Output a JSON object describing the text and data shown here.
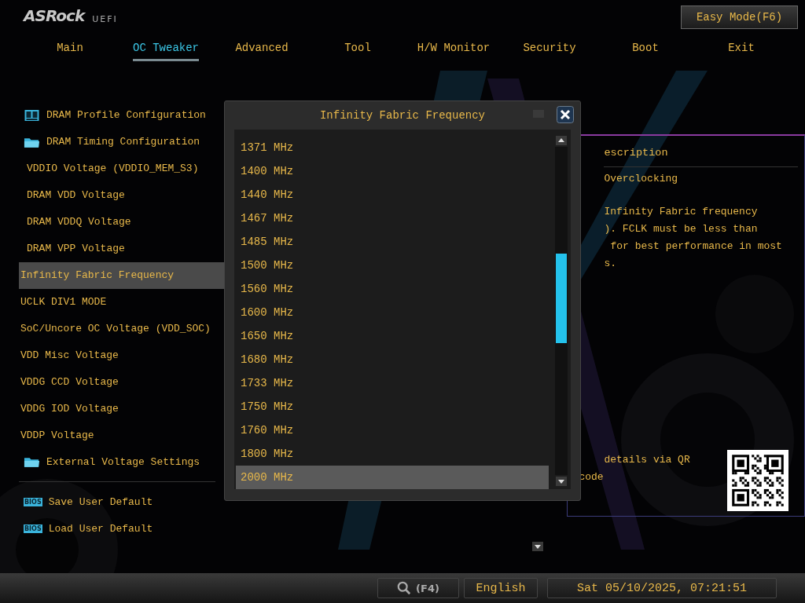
{
  "header": {
    "logo": "ASRock",
    "logo_suffix": "UEFI",
    "easy_mode_button": "Easy Mode(F6)"
  },
  "tabs": [
    {
      "label": "Main",
      "selected": false
    },
    {
      "label": "OC Tweaker",
      "selected": true
    },
    {
      "label": "Advanced",
      "selected": false
    },
    {
      "label": "Tool",
      "selected": false
    },
    {
      "label": "H/W Monitor",
      "selected": false
    },
    {
      "label": "Security",
      "selected": false
    },
    {
      "label": "Boot",
      "selected": false
    },
    {
      "label": "Exit",
      "selected": false
    }
  ],
  "menu": {
    "items": [
      {
        "label": "DRAM Profile Configuration",
        "kind": "profile",
        "selected": false
      },
      {
        "label": "DRAM Timing Configuration",
        "kind": "folder",
        "selected": false
      },
      {
        "label": "VDDIO Voltage (VDDIO_MEM_S3)",
        "kind": "sub",
        "selected": false
      },
      {
        "label": "DRAM VDD Voltage",
        "kind": "sub",
        "selected": false
      },
      {
        "label": "DRAM VDDQ Voltage",
        "kind": "sub",
        "selected": false
      },
      {
        "label": "DRAM VPP Voltage",
        "kind": "sub",
        "selected": false
      },
      {
        "label": "Infinity Fabric Frequency",
        "kind": "plain",
        "selected": true
      },
      {
        "label": "UCLK DIV1 MODE",
        "kind": "plain",
        "selected": false
      },
      {
        "label": "SoC/Uncore OC Voltage (VDD_SOC)",
        "kind": "plain",
        "selected": false
      },
      {
        "label": "VDD Misc Voltage",
        "kind": "plain",
        "selected": false
      },
      {
        "label": "VDDG CCD Voltage",
        "kind": "plain",
        "selected": false
      },
      {
        "label": "VDDG IOD Voltage",
        "kind": "plain",
        "selected": false
      },
      {
        "label": "VDDP Voltage",
        "kind": "plain",
        "selected": false
      },
      {
        "label": "External Voltage Settings",
        "kind": "folder",
        "selected": false
      }
    ],
    "actions": [
      {
        "label": "Save User Default",
        "badge": "BIOS"
      },
      {
        "label": "Load User Default",
        "badge": "BIOS"
      }
    ]
  },
  "description": {
    "title": "escription",
    "lines": [
      "Overclocking",
      "Infinity Fabric frequency",
      "). FCLK must be less than",
      "for best performance in most",
      "s."
    ],
    "qr_text": "details via QR",
    "qr_text_2": "code"
  },
  "dialog": {
    "title": "Infinity Fabric Frequency",
    "options": [
      {
        "label": "1371 MHz",
        "selected": false
      },
      {
        "label": "1400 MHz",
        "selected": false
      },
      {
        "label": "1440 MHz",
        "selected": false
      },
      {
        "label": "1467 MHz",
        "selected": false
      },
      {
        "label": "1485 MHz",
        "selected": false
      },
      {
        "label": "1500 MHz",
        "selected": false
      },
      {
        "label": "1560 MHz",
        "selected": false
      },
      {
        "label": "1600 MHz",
        "selected": false
      },
      {
        "label": "1650 MHz",
        "selected": false
      },
      {
        "label": "1680 MHz",
        "selected": false
      },
      {
        "label": "1733 MHz",
        "selected": false
      },
      {
        "label": "1750 MHz",
        "selected": false
      },
      {
        "label": "1760 MHz",
        "selected": false
      },
      {
        "label": "1800 MHz",
        "selected": false
      },
      {
        "label": "2000 MHz",
        "selected": true
      }
    ]
  },
  "status_bar": {
    "search_key": "(F4)",
    "language": "English",
    "datetime": "Sat 05/10/2025, 07:21:51"
  }
}
